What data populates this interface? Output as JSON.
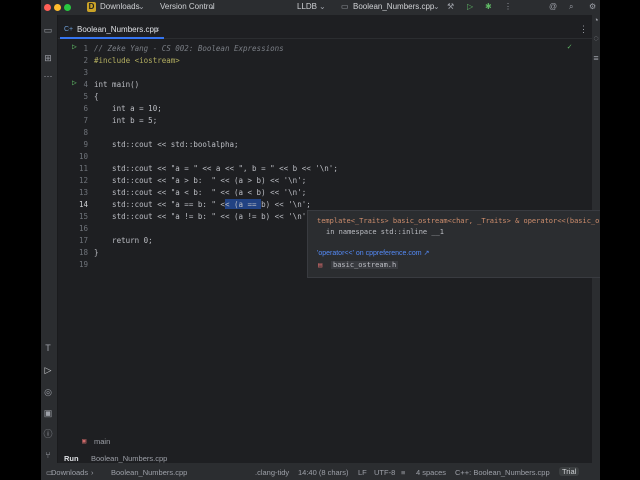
{
  "titlebar": {
    "project": "Downloads",
    "vcs": "Version Control",
    "debugger": "LLDB",
    "run_config": "Boolean_Numbers.cpp"
  },
  "editor_tab": {
    "label": "Boolean_Numbers.cpp"
  },
  "code_lines": [
    {
      "n": "1",
      "text": "// Zeke Yang - CS 002: Boolean Expressions"
    },
    {
      "n": "2",
      "text": "#include <iostream>"
    },
    {
      "n": "3",
      "text": ""
    },
    {
      "n": "4",
      "text": "int main()"
    },
    {
      "n": "5",
      "text": "{"
    },
    {
      "n": "6",
      "text": "    int a = 10;"
    },
    {
      "n": "7",
      "text": "    int b = 5;"
    },
    {
      "n": "8",
      "text": ""
    },
    {
      "n": "9",
      "text": "    std::cout << std::boolalpha;"
    },
    {
      "n": "10",
      "text": ""
    },
    {
      "n": "11",
      "text": "    std::cout << \"a = \" << a << \", b = \" << b << '\\n';"
    },
    {
      "n": "12",
      "text": "    std::cout << \"a > b:  \" << (a > b) << '\\n';"
    },
    {
      "n": "13",
      "text": "    std::cout << \"a < b:  \" << (a < b) << '\\n';"
    },
    {
      "n": "14",
      "text": "    std::cout << \"a == b: \" << (a == b) << '\\n';"
    },
    {
      "n": "15",
      "text": "    std::cout << \"a != b: \" << (a != b) << '\\n';"
    },
    {
      "n": "16",
      "text": ""
    },
    {
      "n": "17",
      "text": "    return 0;"
    },
    {
      "n": "18",
      "text": "}"
    },
    {
      "n": "19",
      "text": ""
    }
  ],
  "popup": {
    "signature": "template<_Traits> basic_ostream<char, _Traits> & operator<<(basic_ostream<char",
    "namespace_line": "in namespace std::inline __1",
    "link": "'operator<<' on cppreference.com ↗",
    "header_file": "basic_ostream.h"
  },
  "breadcrumb": "main",
  "run_panel": {
    "label": "Run",
    "tab": "Boolean_Numbers.cpp"
  },
  "statusbar": {
    "path_root": "Downloads",
    "path_file": "Boolean_Numbers.cpp",
    "linter": ".clang-tidy",
    "position": "14:40 (8 chars)",
    "line_sep": "LF",
    "encoding": "UTF-8",
    "indent": "4 spaces",
    "language": "C++: Boolean_Numbers.cpp",
    "license": "Trial"
  }
}
